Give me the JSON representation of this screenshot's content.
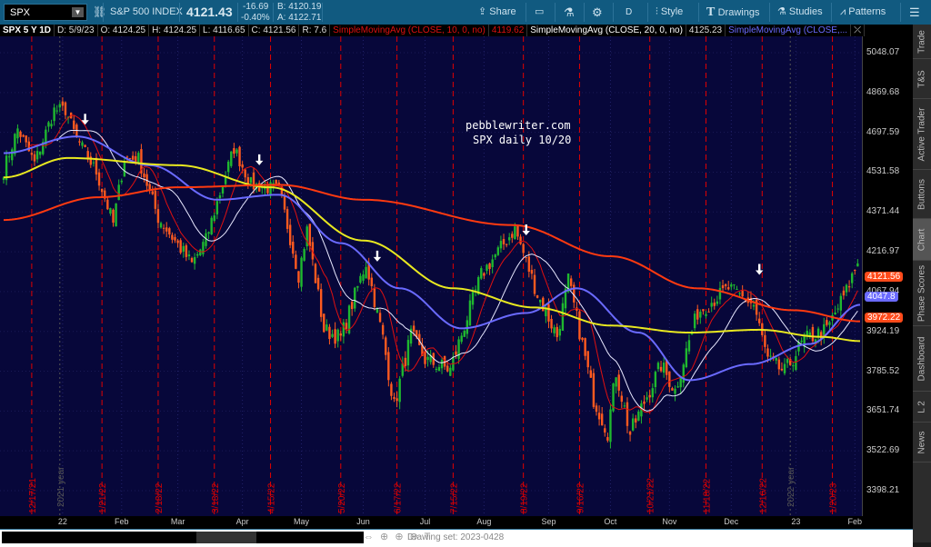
{
  "toolbar": {
    "symbol": "SPX",
    "name": "S&P 500 INDEX",
    "last": "4121.43",
    "change": "-16.69",
    "change_pct": "-0.40%",
    "bid": "B: 4120.19",
    "ask": "A: 4122.71",
    "share": "Share",
    "interval": "D",
    "style": "Style",
    "drawings": "Drawings",
    "studies": "Studies",
    "patterns": "Patterns"
  },
  "info": {
    "period": "SPX 5 Y 1D",
    "date": "D: 5/9/23",
    "open": "O: 4124.25",
    "high": "H: 4124.25",
    "low": "L: 4116.65",
    "close": "C: 4121.56",
    "range": "R: 7.6",
    "sma1": "SimpleMovingAvg (CLOSE, 10, 0, no)",
    "sma1_val": "4119.62",
    "sma2": "SimpleMovingAvg (CLOSE, 20, 0, no)",
    "sma2_val": "4125.23",
    "sma3": "SimpleMovingAvg (CLOSE,..."
  },
  "watermark": {
    "line1": "pebblewriter.com",
    "line2": "SPX daily 10/20"
  },
  "side_tabs": [
    "Trade",
    "T&S",
    "Active Trader",
    "Buttons",
    "Chart",
    "Phase Scores",
    "Dashboard",
    "L 2",
    "News"
  ],
  "bottom": {
    "drawing_set": "Drawing set: 2023-0428"
  },
  "chart_data": {
    "type": "candlestick",
    "scale": "log",
    "y_ticks": [
      "5048.07",
      "4869.68",
      "4697.59",
      "4531.58",
      "4371.44",
      "4216.97",
      "4067.94",
      "3924.19",
      "3785.52",
      "3651.74",
      "3522.69",
      "3398.21"
    ],
    "x_ticks": [
      [
        "22",
        "2022-01-03"
      ],
      [
        "Feb",
        "2022-02-01"
      ],
      [
        "Mar",
        "2022-03-01"
      ],
      [
        "Apr",
        "2022-04-01"
      ],
      [
        "May",
        "2022-05-02"
      ],
      [
        "Jun",
        "2022-06-01"
      ],
      [
        "Jul",
        "2022-07-01"
      ],
      [
        "Aug",
        "2022-08-01"
      ],
      [
        "Sep",
        "2022-09-01"
      ],
      [
        "Oct",
        "2022-10-03"
      ],
      [
        "Nov",
        "2022-11-01"
      ],
      [
        "Dec",
        "2022-12-01"
      ],
      [
        "23",
        "2023-01-03"
      ],
      [
        "Feb",
        "2023-02-01"
      ]
    ],
    "price_labels": [
      {
        "value": "4121.56",
        "color": "#ff4a1a"
      },
      {
        "value": "4047.8",
        "color": "#6a6aff"
      },
      {
        "value": "3972.22",
        "color": "#ff4a1a"
      }
    ],
    "closes": [
      [
        "2021-12-03",
        4540
      ],
      [
        "2021-12-10",
        4712
      ],
      [
        "2021-12-20",
        4568
      ],
      [
        "2021-12-29",
        4793
      ],
      [
        "2022-01-04",
        4794
      ],
      [
        "2022-01-10",
        4670
      ],
      [
        "2022-01-19",
        4532
      ],
      [
        "2022-01-27",
        4326
      ],
      [
        "2022-02-02",
        4589
      ],
      [
        "2022-02-09",
        4587
      ],
      [
        "2022-02-18",
        4349
      ],
      [
        "2022-02-24",
        4288
      ],
      [
        "2022-03-08",
        4170
      ],
      [
        "2022-03-15",
        4262
      ],
      [
        "2022-03-29",
        4631
      ],
      [
        "2022-04-06",
        4481
      ],
      [
        "2022-04-20",
        4459
      ],
      [
        "2022-04-29",
        4131
      ],
      [
        "2022-05-04",
        4300
      ],
      [
        "2022-05-12",
        3930
      ],
      [
        "2022-05-20",
        3901
      ],
      [
        "2022-06-02",
        4176
      ],
      [
        "2022-06-10",
        3900
      ],
      [
        "2022-06-16",
        3667
      ],
      [
        "2022-06-24",
        3912
      ],
      [
        "2022-07-01",
        3825
      ],
      [
        "2022-07-14",
        3790
      ],
      [
        "2022-07-29",
        4130
      ],
      [
        "2022-08-16",
        4305
      ],
      [
        "2022-08-26",
        4057
      ],
      [
        "2022-09-06",
        3908
      ],
      [
        "2022-09-12",
        4110
      ],
      [
        "2022-09-23",
        3693
      ],
      [
        "2022-09-30",
        3585
      ],
      [
        "2022-10-05",
        3783
      ],
      [
        "2022-10-12",
        3577
      ],
      [
        "2022-10-27",
        3807
      ],
      [
        "2022-11-03",
        3720
      ],
      [
        "2022-11-15",
        3992
      ],
      [
        "2022-11-30",
        4080
      ],
      [
        "2022-12-13",
        4019
      ],
      [
        "2022-12-20",
        3822
      ],
      [
        "2022-12-28",
        3783
      ],
      [
        "2023-01-06",
        3895
      ],
      [
        "2023-01-18",
        3929
      ],
      [
        "2023-01-27",
        4070
      ],
      [
        "2023-02-02",
        4179
      ]
    ],
    "moving_averages": [
      {
        "name": "SimpleMovingAvg (CLOSE, 10, 0, no)",
        "period": 10,
        "color": "#e01010"
      },
      {
        "name": "SimpleMovingAvg (CLOSE, 20, 0, no)",
        "period": 20,
        "color": "#e8e8ff"
      },
      {
        "name": "SMA 50",
        "color": "#6a6aff",
        "points": [
          [
            "2021-12-03",
            4610
          ],
          [
            "2022-01-10",
            4680
          ],
          [
            "2022-02-15",
            4560
          ],
          [
            "2022-03-20",
            4420
          ],
          [
            "2022-04-20",
            4440
          ],
          [
            "2022-05-20",
            4250
          ],
          [
            "2022-06-20",
            4080
          ],
          [
            "2022-07-20",
            3935
          ],
          [
            "2022-08-20",
            3990
          ],
          [
            "2022-09-15",
            4080
          ],
          [
            "2022-10-15",
            3920
          ],
          [
            "2022-11-10",
            3755
          ],
          [
            "2022-12-10",
            3810
          ],
          [
            "2023-01-10",
            3880
          ],
          [
            "2023-02-03",
            4020
          ]
        ]
      },
      {
        "name": "SMA 100",
        "color": "#e8e820",
        "points": [
          [
            "2021-12-03",
            4510
          ],
          [
            "2022-01-05",
            4590
          ],
          [
            "2022-03-01",
            4560
          ],
          [
            "2022-04-15",
            4470
          ],
          [
            "2022-06-01",
            4260
          ],
          [
            "2022-07-15",
            4080
          ],
          [
            "2022-08-25",
            4010
          ],
          [
            "2022-10-01",
            3945
          ],
          [
            "2022-11-10",
            3920
          ],
          [
            "2022-12-15",
            3930
          ],
          [
            "2023-01-15",
            3905
          ],
          [
            "2023-02-03",
            3890
          ]
        ]
      },
      {
        "name": "SMA 200",
        "color": "#ff3a10",
        "points": [
          [
            "2021-12-03",
            4340
          ],
          [
            "2022-01-20",
            4430
          ],
          [
            "2022-03-01",
            4470
          ],
          [
            "2022-04-20",
            4480
          ],
          [
            "2022-06-01",
            4420
          ],
          [
            "2022-08-15",
            4320
          ],
          [
            "2022-10-01",
            4200
          ],
          [
            "2022-11-15",
            4080
          ],
          [
            "2023-01-01",
            4000
          ],
          [
            "2023-02-03",
            3960
          ]
        ]
      }
    ],
    "cycle_lines": [
      "12/17/21",
      "1/21/22",
      "2/18/22",
      "3/18/22",
      "4/15/22",
      "5/20/22",
      "6/17/22",
      "7/15/22",
      "8/19/22",
      "9/16/22",
      "10/21/22",
      "11/18/22",
      "12/16/22",
      "1/20/23"
    ],
    "year_lines": [
      [
        "2021 year",
        "2021-12-31"
      ],
      [
        "2022 year",
        "2022-12-30"
      ]
    ],
    "arrows": [
      [
        "2022-01-13",
        4730
      ],
      [
        "2022-04-11",
        4560
      ],
      [
        "2022-06-08",
        4180
      ],
      [
        "2022-08-22",
        4280
      ],
      [
        "2022-12-15",
        4130
      ]
    ],
    "colors": {
      "up": "#1fb82f",
      "down": "#ff5a1f",
      "cycle": "#e00000",
      "background": "#07073a"
    }
  }
}
